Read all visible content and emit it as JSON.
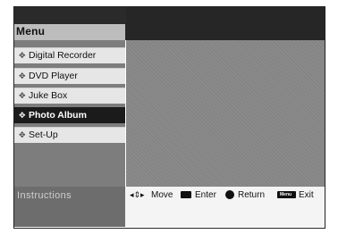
{
  "window": {
    "title": "Menu"
  },
  "menu": {
    "items": [
      {
        "label": "Digital Recorder",
        "selected": false
      },
      {
        "label": "DVD Player",
        "selected": false
      },
      {
        "label": "Juke Box",
        "selected": false
      },
      {
        "label": "Photo Album",
        "selected": true
      },
      {
        "label": "Set-Up",
        "selected": false
      }
    ]
  },
  "instructions": {
    "title": "Instructions",
    "move_label": "Move",
    "enter_label": "Enter",
    "return_label": "Return",
    "exit_label": "Exit",
    "menu_key_label": "Menu"
  },
  "icons": {
    "bullet": "diamond-bullet-icon",
    "move": "up-down-left-right-arrows-icon",
    "enter": "enter-key-icon",
    "return": "return-circle-icon",
    "menu": "menu-key-icon"
  },
  "colors": {
    "selected_bg": "#1b1b1b",
    "item_bg": "#e6e6e6"
  }
}
